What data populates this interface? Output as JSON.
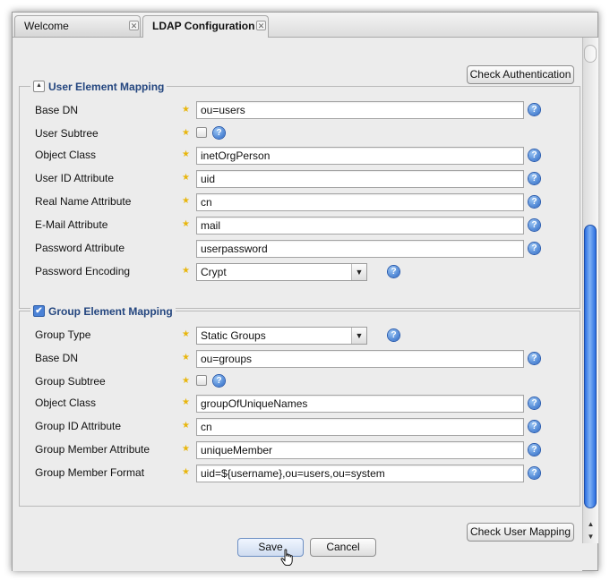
{
  "tabs": [
    {
      "label": "Welcome",
      "active": false
    },
    {
      "label": "LDAP Configuration",
      "active": true
    }
  ],
  "buttons": {
    "check_authentication": "Check Authentication",
    "check_user_mapping": "Check User Mapping",
    "save": "Save",
    "cancel": "Cancel"
  },
  "user_section": {
    "title": "User Element Mapping",
    "expanded": true,
    "fields": {
      "base_dn": {
        "label": "Base DN",
        "value": "ou=users",
        "required": true
      },
      "user_subtree": {
        "label": "User Subtree",
        "checked": false,
        "required": true
      },
      "object_class": {
        "label": "Object Class",
        "value": "inetOrgPerson",
        "required": true
      },
      "user_id_attribute": {
        "label": "User ID Attribute",
        "value": "uid",
        "required": true
      },
      "real_name_attribute": {
        "label": "Real Name Attribute",
        "value": "cn",
        "required": true
      },
      "email_attribute": {
        "label": "E-Mail Attribute",
        "value": "mail",
        "required": true
      },
      "password_attribute": {
        "label": "Password Attribute",
        "value": "userpassword",
        "required": false
      },
      "password_encoding": {
        "label": "Password Encoding",
        "value": "Crypt",
        "required": true
      }
    }
  },
  "group_section": {
    "title": "Group Element Mapping",
    "enabled": true,
    "fields": {
      "group_type": {
        "label": "Group Type",
        "value": "Static Groups",
        "required": true
      },
      "base_dn": {
        "label": "Base DN",
        "value": "ou=groups",
        "required": true
      },
      "group_subtree": {
        "label": "Group Subtree",
        "checked": false,
        "required": true
      },
      "object_class": {
        "label": "Object Class",
        "value": "groupOfUniqueNames",
        "required": true
      },
      "group_id_attribute": {
        "label": "Group ID Attribute",
        "value": "cn",
        "required": true
      },
      "group_member_attribute": {
        "label": "Group Member Attribute",
        "value": "uniqueMember",
        "required": true
      },
      "group_member_format": {
        "label": "Group Member Format",
        "value": "uid=${username},ou=users,ou=system",
        "required": true
      }
    }
  },
  "icons": {
    "required": "star-icon",
    "help": "help-icon",
    "tab_close": "close-icon",
    "dropdown": "chevron-down-icon",
    "collapse": "collapse-up-icon"
  },
  "glyphs": {
    "star": "★",
    "help": "?",
    "close": "✕",
    "caret": "▼",
    "collapse": "▲",
    "check": "✔",
    "scroll_up": "▲",
    "scroll_down": "▼"
  },
  "colors": {
    "section_title": "#24467f",
    "required_star": "#e8b60d",
    "help_icon": "#2a67c5",
    "scroll_thumb": "#2b6ee0"
  }
}
